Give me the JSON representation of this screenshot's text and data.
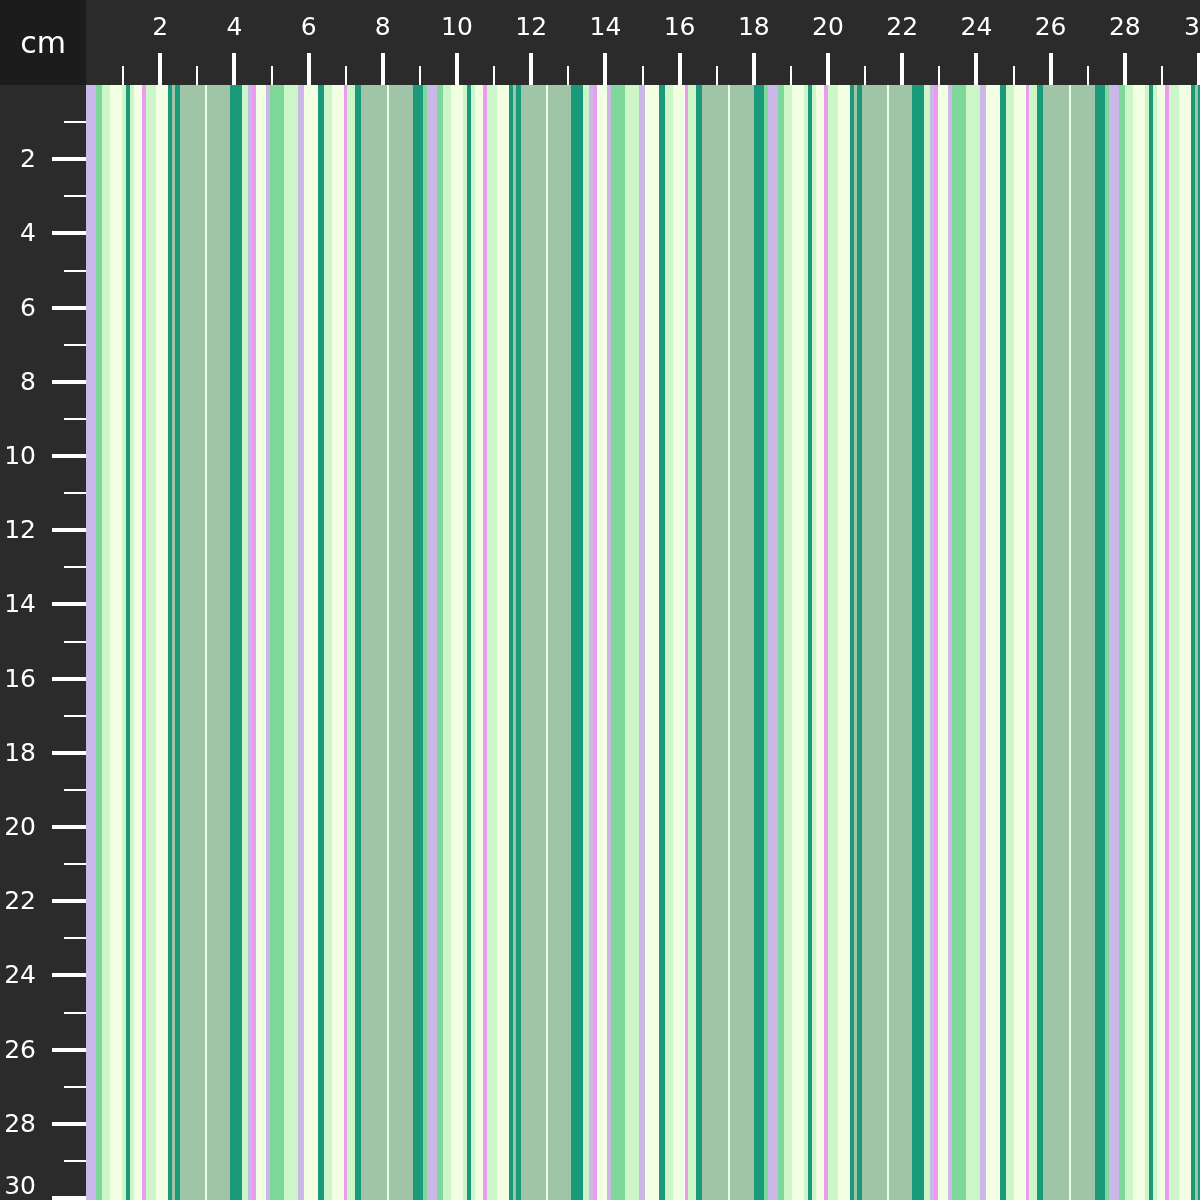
{
  "unit": "cm",
  "top_ruler": {
    "labels": [
      "2",
      "4",
      "6",
      "8",
      "10",
      "12",
      "14",
      "16",
      "18",
      "20",
      "22",
      "24",
      "26",
      "28",
      "3"
    ]
  },
  "left_ruler": {
    "labels": [
      "2",
      "4",
      "6",
      "8",
      "10",
      "12",
      "14",
      "16",
      "18",
      "20",
      "22",
      "24",
      "26",
      "28",
      "30"
    ]
  }
}
